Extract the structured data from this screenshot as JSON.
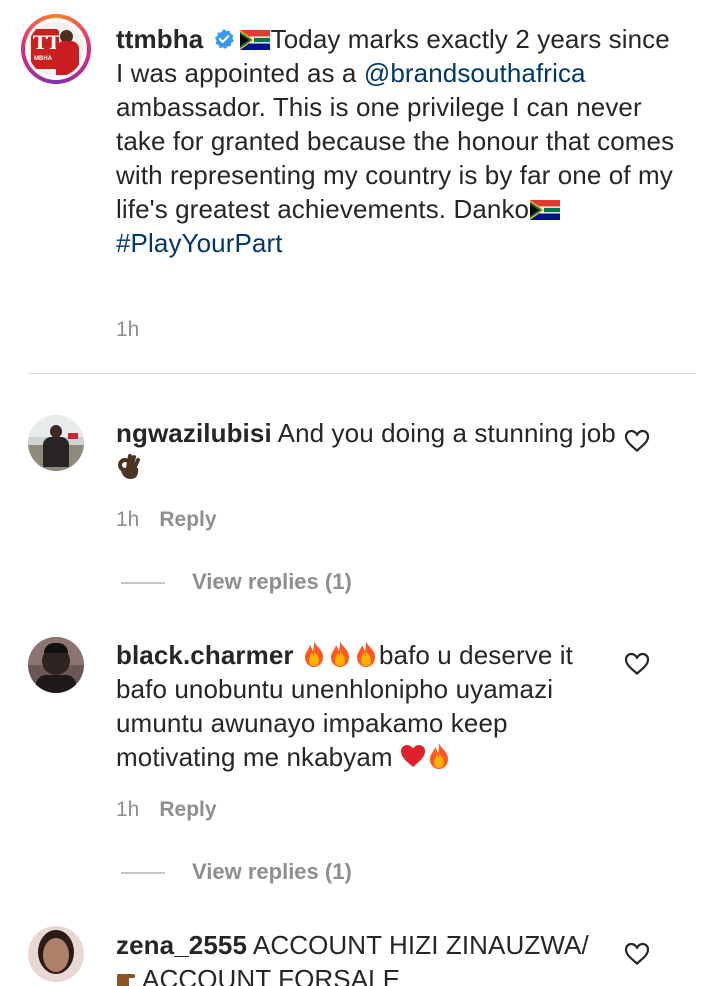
{
  "caption": {
    "username": "ttmbha",
    "logo_text_top": "TT",
    "logo_text_bottom": "MBHA",
    "text_part1": "Today marks exactly 2 years since I was appointed as a ",
    "mention": "@brandsouthafrica",
    "text_part2": " ambassador. This is one privilege I can never take for granted because the honour that comes with representing my country is by far one of my life's greatest achievements. Danko",
    "hashtag": "#PlayYourPart",
    "time": "1h"
  },
  "comments": [
    {
      "username": "ngwazilubisi",
      "text": "And you doing a stunning job",
      "time": "1h",
      "reply_label": "Reply",
      "view_replies": "View replies (1)"
    },
    {
      "username": "black.charmer",
      "text_part1": "bafo u deserve it bafo unobuntu unenhlonipho uyamazi umuntu awunayo impakamo keep motivating me nkabyam",
      "time": "1h",
      "reply_label": "Reply",
      "view_replies": "View replies (1)"
    },
    {
      "username": "zena_2555",
      "text_part1": "ACCOUNT HIZI ZINAUZWA/",
      "text_part2": "ACCOUNT FORSALE"
    }
  ],
  "icons": {
    "verified": "verified-badge-icon",
    "like": "heart-outline-icon",
    "flag": "south-africa-flag-icon",
    "ok_hand": "ok-hand-emoji",
    "fire": "fire-emoji",
    "red_heart": "red-heart-emoji",
    "pointing": "pointing-right-emoji"
  },
  "colors": {
    "link": "#00376b",
    "meta": "#8e8e8e",
    "verified": "#3897f0"
  }
}
